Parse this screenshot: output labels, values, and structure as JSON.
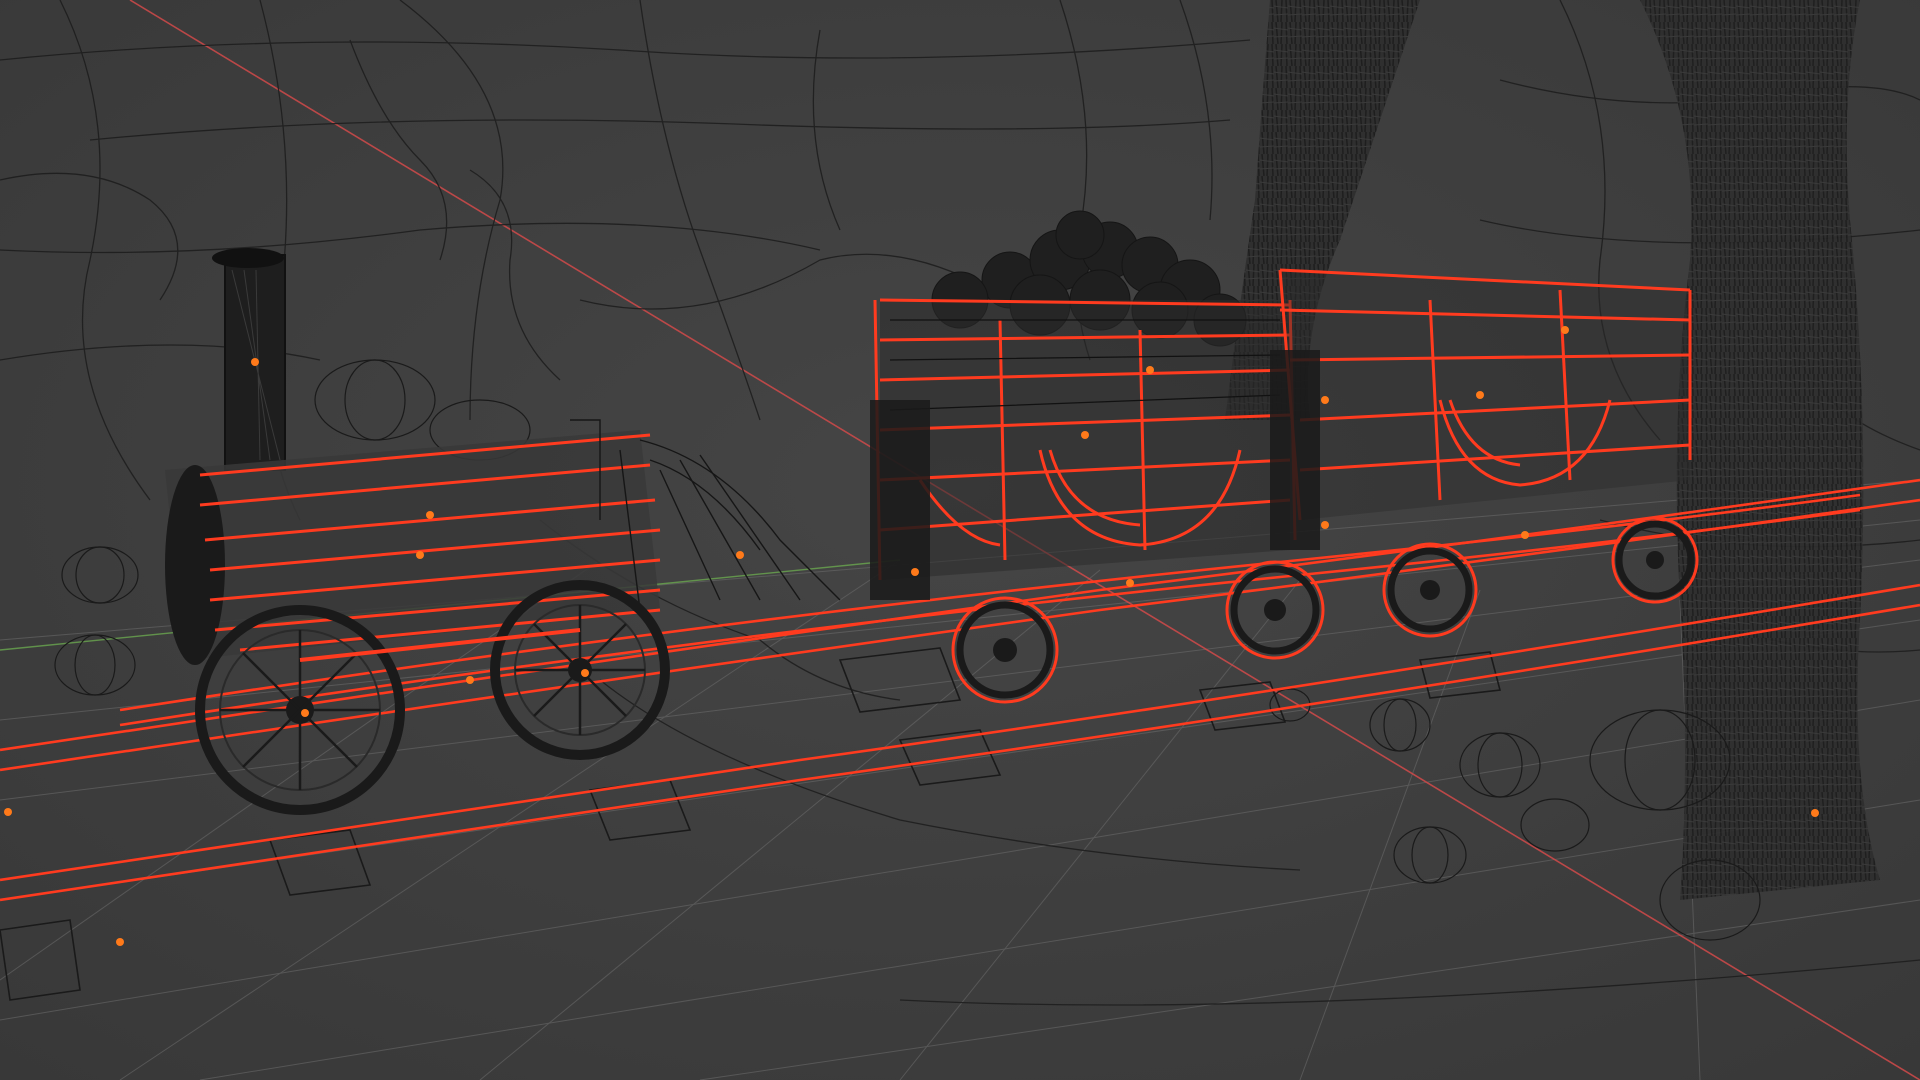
{
  "app": {
    "name": "3D viewport",
    "view_mode": "wireframe"
  },
  "viewport": {
    "background_color": "#3d3d3d",
    "grid_color": "#6e6e6e",
    "x_axis_color": "#d24a4a",
    "y_axis_color": "#6aa84f",
    "wire_color": "#1a1a1a",
    "selected_wire_color": "#ff3b1f",
    "origin_dot_color": "#ff7a1a"
  },
  "scene": {
    "objects": [
      {
        "name": "locomotive",
        "selected": true
      },
      {
        "name": "coal-wagon-front",
        "selected": true
      },
      {
        "name": "coal-wagon-rear",
        "selected": true
      },
      {
        "name": "coal-pile",
        "selected": false
      },
      {
        "name": "rails",
        "selected": true
      },
      {
        "name": "sleepers",
        "selected": false
      },
      {
        "name": "tree-trunk-left",
        "selected": false
      },
      {
        "name": "tree-trunk-right",
        "selected": false
      },
      {
        "name": "rocks",
        "selected": false
      },
      {
        "name": "cave-walls",
        "selected": false
      }
    ]
  }
}
